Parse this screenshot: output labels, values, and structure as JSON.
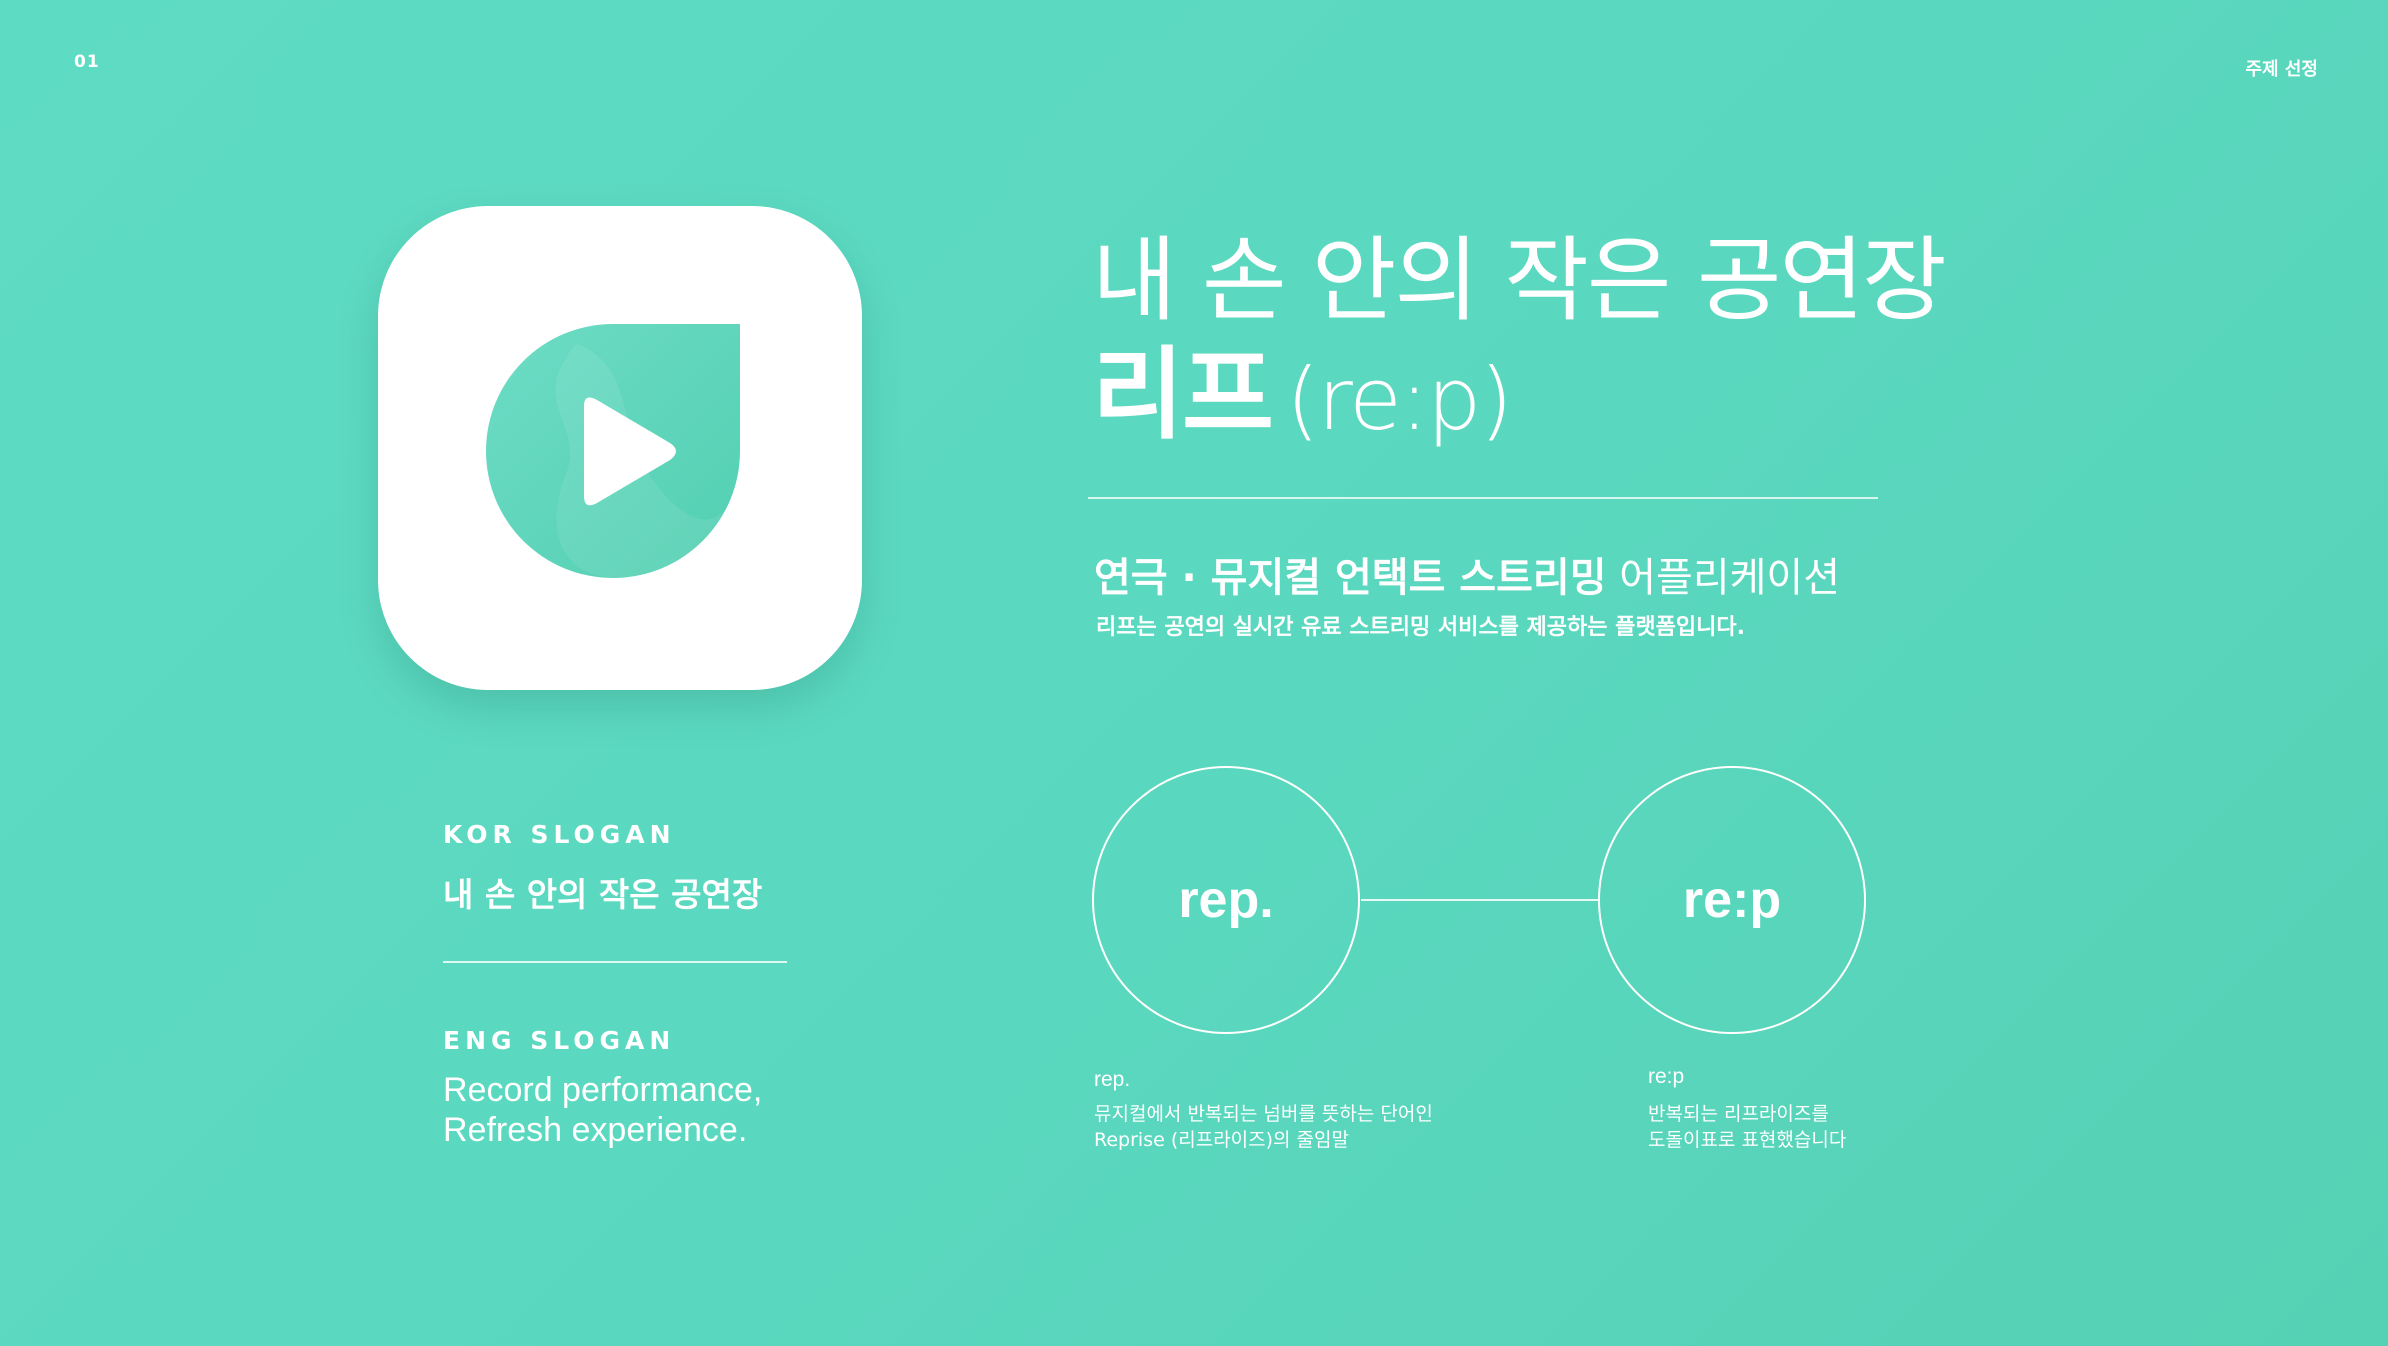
{
  "header": {
    "page_number": "01",
    "section_title": "주제 선정"
  },
  "app_icon": {
    "icon": "play-leaf-icon",
    "colors": {
      "background": "#ffffff",
      "leaf": "#5fd6bb",
      "play": "#ffffff"
    }
  },
  "headline": {
    "line1": "내 손 안의 작은 공연장",
    "name_bold": "리프",
    "name_sub": "(re:p)"
  },
  "tagline": {
    "bold1": "연극 · 뮤지컬 언택트 스트리밍",
    "light": " 어플리케이션",
    "description": "리프는 공연의 실시간 유료 스트리밍 서비스를 제공하는 플랫폼입니다."
  },
  "slogans": {
    "kor_label": "KOR SLOGAN",
    "kor_text": "내 손 안의 작은 공연장",
    "eng_label": "ENG SLOGAN",
    "eng_line1": "Record performance,",
    "eng_line2": "Refresh experience."
  },
  "diagram": {
    "circle1": "rep.",
    "circle2": "re:p",
    "caption1_title": "rep.",
    "caption1_line1": "뮤지컬에서 반복되는 넘버를 뜻하는 단어인",
    "caption1_line2": "Reprise (리프라이즈)의 줄임말",
    "caption2_title": "re:p",
    "caption2_line1": "반복되는 리프라이즈를",
    "caption2_line2": "도돌이표로 표현했습니다"
  },
  "theme": {
    "background": "#5ad8bf",
    "text": "#ffffff"
  }
}
